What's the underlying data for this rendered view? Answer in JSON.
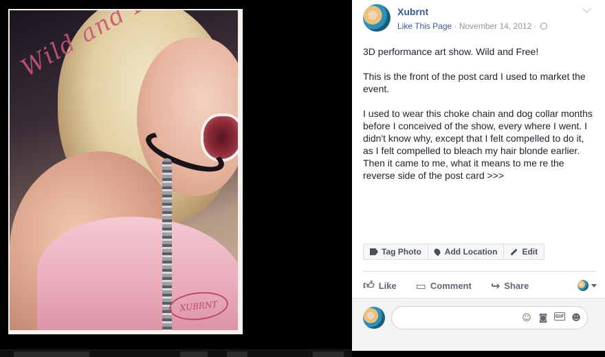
{
  "post": {
    "page_name": "Xubrnt",
    "like_page": "Like This Page",
    "separator": " · ",
    "date": "November 14, 2012",
    "paragraphs": [
      "3D performance art show. Wild and Free!",
      "This is the front of the post card I used to market the event.",
      "I used to wear this choke chain and dog collar months before I conceived of the show, every where I went. I didn't know why, except that I felt compelled to do it, as I felt compelled to bleach my hair blonde earlier. Then it came to me, what it means to me re the reverse side of the post card >>>"
    ]
  },
  "photo": {
    "overlay_text": "Wild and Free!",
    "signature": "XUBRNT"
  },
  "photo_actions": {
    "tag": "Tag Photo",
    "location": "Add Location",
    "edit": "Edit"
  },
  "ufi": {
    "like": "Like",
    "comment": "Comment",
    "share": "Share"
  },
  "comment_box": {
    "placeholder": ""
  },
  "icons": {
    "globe": "globe-icon",
    "like": "thumbs-up-icon",
    "comment": "speech-bubble-icon",
    "share": "share-arrow-icon",
    "emoji": "smiley-icon",
    "camera": "camera-icon",
    "gif": "gif-icon",
    "sticker": "sticker-icon"
  },
  "colors": {
    "link": "#365899",
    "meta": "#90949c",
    "text": "#1d2129",
    "background": "#000000"
  }
}
